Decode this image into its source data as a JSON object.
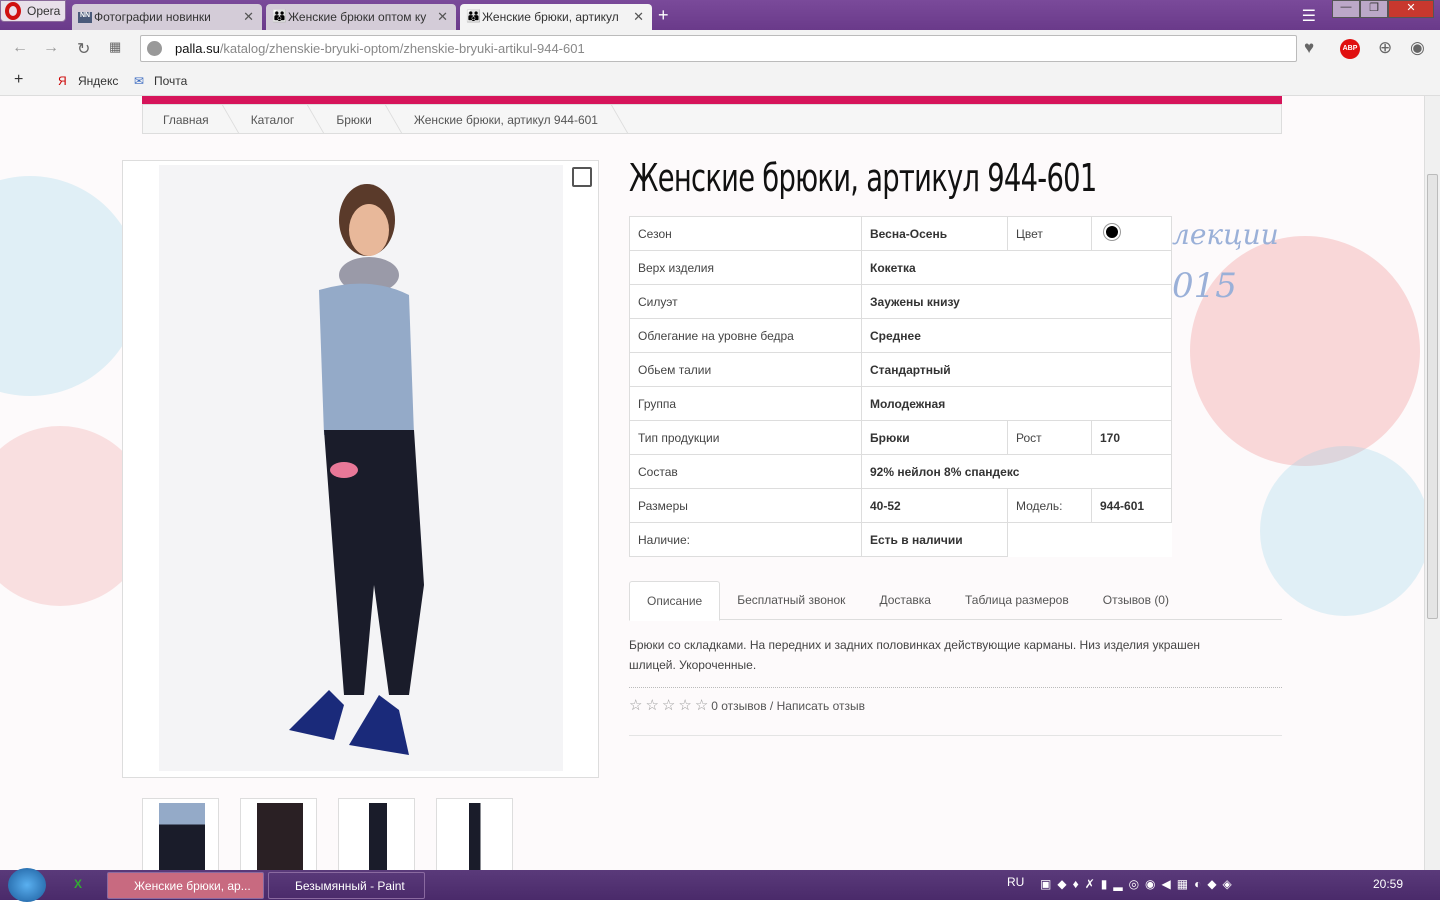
{
  "browser": {
    "opera_label": "Opera",
    "tabs": [
      {
        "label": "Фотографии новинки",
        "favicon": "NN"
      },
      {
        "label": "Женские брюки оптом ку"
      },
      {
        "label": "Женские брюки, артикул"
      }
    ],
    "url_domain": "palla.su",
    "url_path": "/katalog/zhenskie-bryuki-optom/zhenskie-bryuki-artikul-944-601",
    "bookmarks": [
      "Яндекс",
      "Почта"
    ]
  },
  "breadcrumbs": [
    "Главная",
    "Каталог",
    "Брюки",
    "Женские брюки, артикул 944-601"
  ],
  "product": {
    "title": "Женские брюки, артикул 944-601",
    "specs": [
      {
        "label": "Сезон",
        "value": "Весна-Осень",
        "label2": "Цвет",
        "color": "#000000"
      },
      {
        "label": "Верх изделия",
        "value": "Кокетка"
      },
      {
        "label": "Силуэт",
        "value": "Заужены книзу"
      },
      {
        "label": "Облегание на уровне бедра",
        "value": "Среднее"
      },
      {
        "label": "Обьем талии",
        "value": "Стандартный"
      },
      {
        "label": "Группа",
        "value": "Молодежная"
      },
      {
        "label": "Тип продукции",
        "value": "Брюки",
        "label2": "Рост",
        "value2": "170"
      },
      {
        "label": "Состав",
        "value": "92% нейлон 8% спандекс"
      },
      {
        "label": "Размеры",
        "value": "40-52",
        "label2": "Модель:",
        "value2": "944-601"
      },
      {
        "label": "Наличие:",
        "value": "Есть в наличии"
      }
    ],
    "tabs": [
      "Описание",
      "Бесплатный звонок",
      "Доставка",
      "Таблица размеров",
      "Отзывов (0)"
    ],
    "description": "Брюки со складками. На передних и задних половинках действующие карманы. Низ изделия украшен шлицей. Укороченные.",
    "rating": 0,
    "reviews_text": "0 отзывов / Написать отзыв"
  },
  "watermark": [
    "лекции",
    "015"
  ],
  "taskbar": {
    "items": [
      "Женские брюки, ар...",
      "Безымянный - Paint"
    ],
    "lang": "RU",
    "time": "20:59"
  }
}
